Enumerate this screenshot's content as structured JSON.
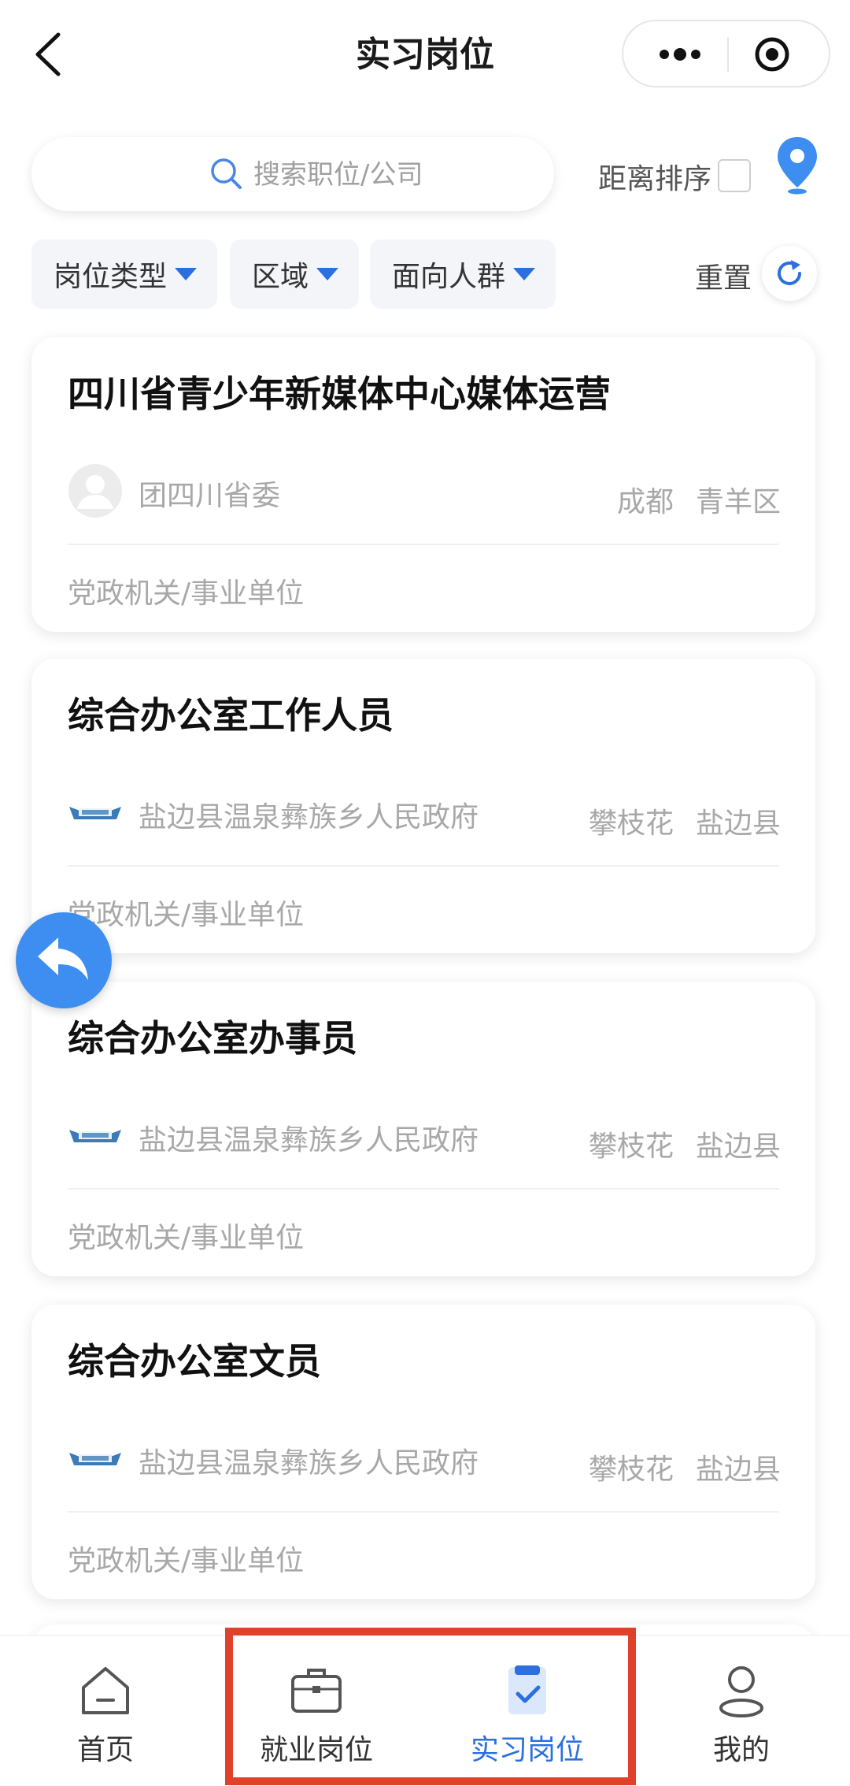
{
  "nav": {
    "title": "实习岗位"
  },
  "search": {
    "placeholder": "搜索职位/公司",
    "distance_sort_label": "距离排序",
    "distance_sort_checked": false
  },
  "filters": {
    "items": [
      "岗位类型",
      "区域",
      "面向人群"
    ],
    "reset_label": "重置"
  },
  "jobs": [
    {
      "title": "四川省青少年新媒体中心媒体运营",
      "company": "团四川省委",
      "logo": "avatar-placeholder-icon",
      "city": "成都",
      "district": "青羊区",
      "category": "党政机关/事业单位"
    },
    {
      "title": "综合办公室工作人员",
      "company": "盐边县温泉彝族乡人民政府",
      "logo": "org-logo-icon",
      "city": "攀枝花",
      "district": "盐边县",
      "category": "党政机关/事业单位"
    },
    {
      "title": "综合办公室办事员",
      "company": "盐边县温泉彝族乡人民政府",
      "logo": "org-logo-icon",
      "city": "攀枝花",
      "district": "盐边县",
      "category": "党政机关/事业单位"
    },
    {
      "title": "综合办公室文员",
      "company": "盐边县温泉彝族乡人民政府",
      "logo": "org-logo-icon",
      "city": "攀枝花",
      "district": "盐边县",
      "category": "党政机关/事业单位"
    }
  ],
  "tabbar": {
    "tabs": [
      {
        "label": "首页",
        "icon": "home-icon",
        "active": false
      },
      {
        "label": "就业岗位",
        "icon": "briefcase-icon",
        "active": false
      },
      {
        "label": "实习岗位",
        "icon": "clipboard-check-icon",
        "active": true
      },
      {
        "label": "我的",
        "icon": "user-icon",
        "active": false
      }
    ]
  },
  "colors": {
    "accent": "#2b6fe0",
    "fab": "#3d8ef0",
    "highlight": "#e0412b",
    "muted_text": "#a8a8a8"
  }
}
